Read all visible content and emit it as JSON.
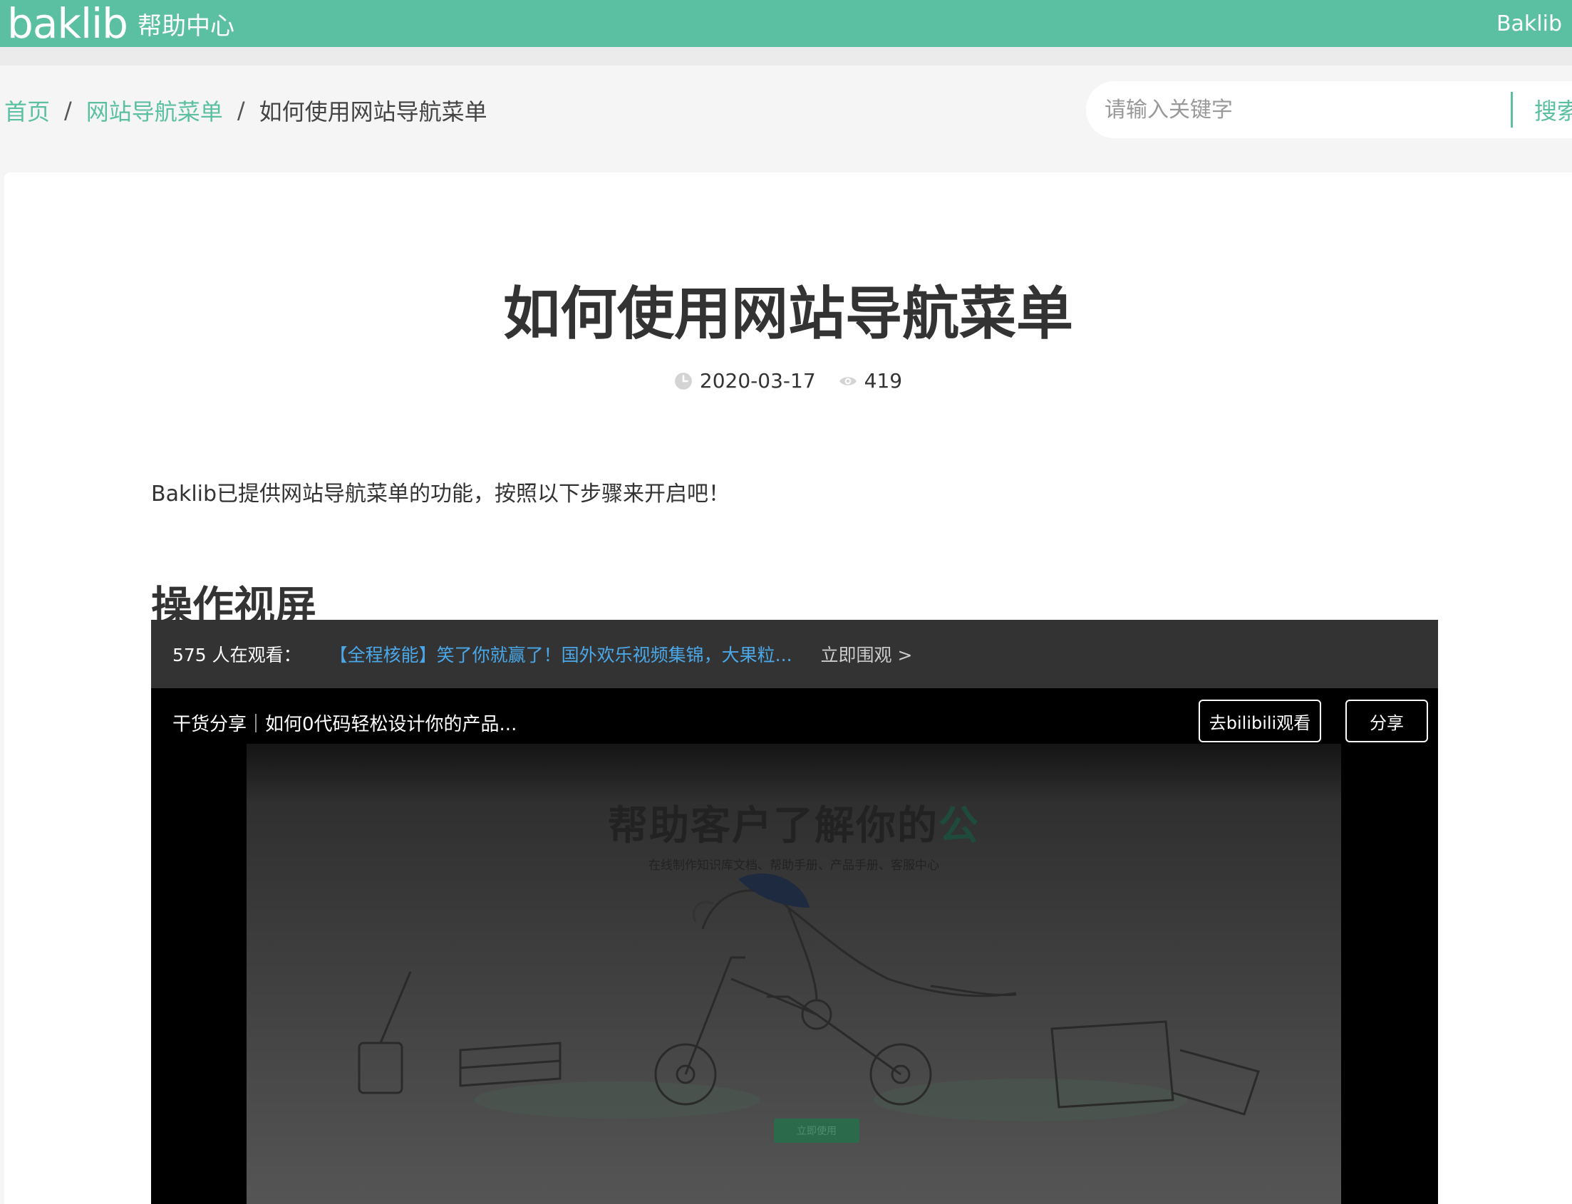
{
  "header": {
    "logo": "baklib",
    "subtitle": "帮助中心",
    "right_link": "Baklib"
  },
  "breadcrumb": {
    "items": [
      "首页",
      "网站导航菜单"
    ],
    "separator": "/",
    "current": "如何使用网站导航菜单"
  },
  "search": {
    "placeholder": "请输入关键字",
    "button_label": "搜索"
  },
  "article": {
    "title": "如何使用网站导航菜单",
    "date": "2020-03-17",
    "views": "419",
    "intro": "Baklib已提供网站导航菜单的功能，按照以下步骤来开启吧！",
    "section_title": "操作视屏"
  },
  "video": {
    "viewer_count": "575 人在观看：",
    "live_title": "【全程核能】笑了你就赢了！国外欢乐视频集锦，大果粒...",
    "live_cta": "立即围观 >",
    "title": "干货分享｜如何0代码轻松设计你的产品...",
    "bilibili_button": "去bilibili观看",
    "share_button": "分享",
    "frame_heading_main": "帮助客户了解你的",
    "frame_heading_accent": "公",
    "frame_subtitle": "在线制作知识库文档、帮助手册、产品手册、客服中心",
    "frame_button": "立即使用"
  },
  "icons": {
    "date": "clock-icon",
    "views": "eye-icon"
  },
  "colors": {
    "brand": "#5bbfa1",
    "link_blue": "#4aa8e8",
    "live_bar": "#333333"
  }
}
